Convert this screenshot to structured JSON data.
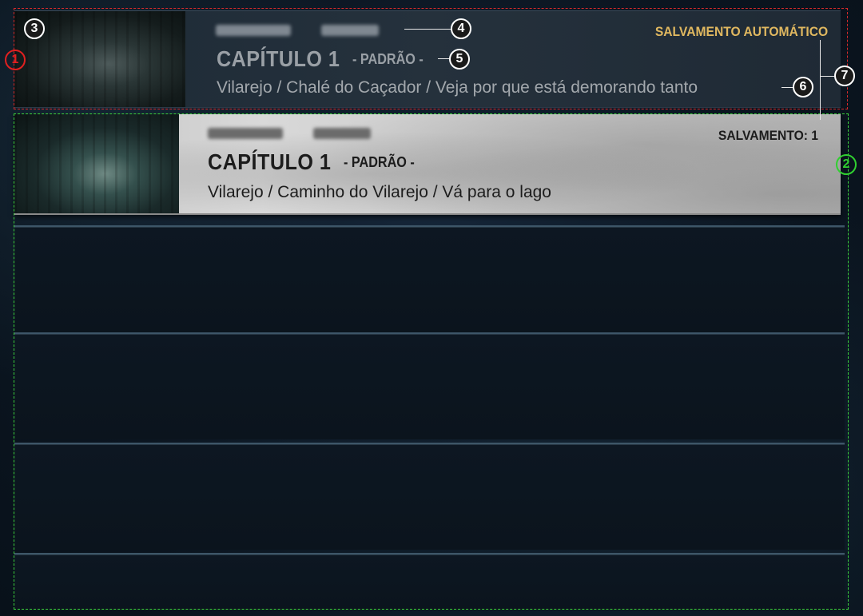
{
  "slots": [
    {
      "tag": "SALVAMENTO AUTOMÁTICO",
      "chapter": "CAPÍTULO 1",
      "difficulty": "- PADRÃO -",
      "location": "Vilarejo / Chalé do Caçador / Veja por que está demorando tanto"
    },
    {
      "tag": "SALVAMENTO: 1",
      "chapter": "CAPÍTULO 1",
      "difficulty": "- PADRÃO -",
      "location": "Vilarejo / Caminho do Vilarejo / Vá para o lago"
    }
  ],
  "badges": {
    "b1": "1",
    "b2": "2",
    "b3": "3",
    "b4": "4",
    "b5": "5",
    "b6": "6",
    "b7": "7"
  },
  "colors": {
    "autosave_tag": "#e0b860",
    "frame_red": "#d42a2a",
    "frame_green": "#3cd23c",
    "selected_bg": "#d0d0d0"
  }
}
